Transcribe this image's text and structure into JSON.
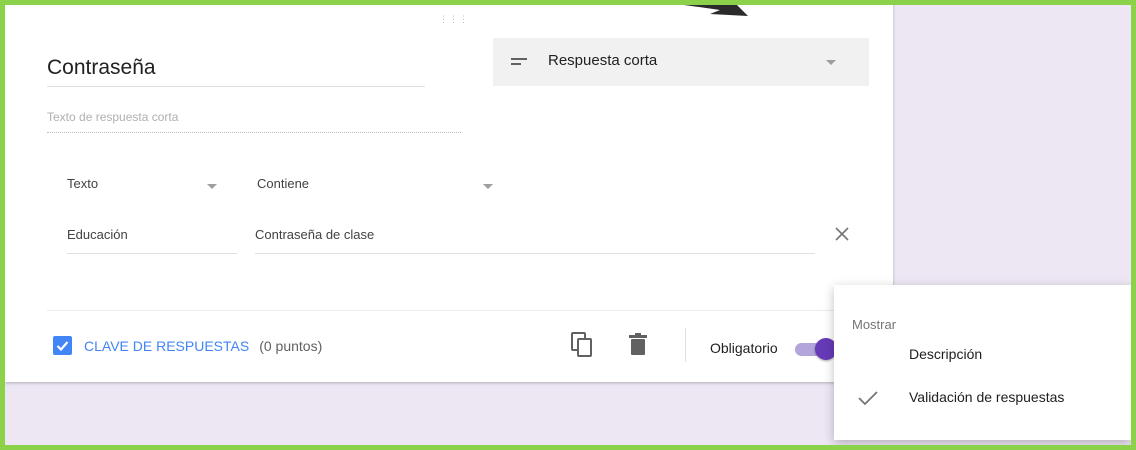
{
  "question": {
    "title": "Contraseña",
    "type_label": "Respuesta corta",
    "short_answer_placeholder": "Texto de respuesta corta"
  },
  "validation": {
    "category": "Texto",
    "condition": "Contiene",
    "text_value": "Educación",
    "error_text": "Contraseña de clase"
  },
  "footer": {
    "answer_key_label": "CLAVE DE RESPUESTAS",
    "points_label": "(0 puntos)",
    "required_label": "Obligatorio",
    "required_on": true
  },
  "menu": {
    "header": "Mostrar",
    "items": [
      {
        "label": "Descripción",
        "checked": false
      },
      {
        "label": "Validación de respuestas",
        "checked": true
      }
    ]
  },
  "colors": {
    "accent": "#673ab7",
    "link": "#4285f4",
    "frame": "#8bd14a",
    "background": "#ede7f4"
  }
}
